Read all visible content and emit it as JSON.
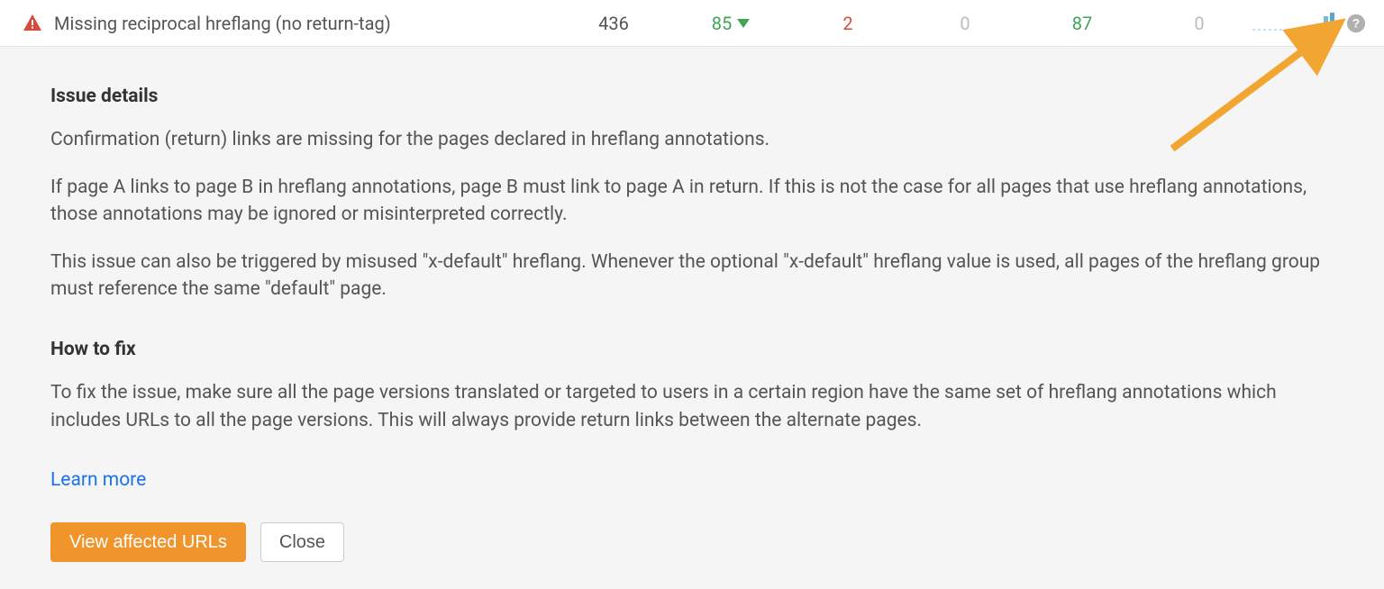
{
  "row": {
    "title": "Missing reciprocal hreflang (no return-tag)",
    "total": "436",
    "change": "85",
    "new": "2",
    "zero1": "0",
    "fixed": "87",
    "zero2": "0"
  },
  "details": {
    "heading": "Issue details",
    "p1": "Confirmation (return) links are missing for the pages declared in hreflang annotations.",
    "p2": "If page A links to page B in hreflang annotations, page B must link to page A in return. If this is not the case for all pages that use hreflang annotations, those annotations may be ignored or misinterpreted correctly.",
    "p3": "This issue can also be triggered by misused \"x-default\" hreflang. Whenever the optional \"x-default\" hreflang value is used, all pages of the hreflang group must reference the same \"default\" page."
  },
  "fix": {
    "heading": "How to fix",
    "p1": "To fix the issue, make sure all the page versions translated or targeted to users in a certain region have the same set of hreflang annotations which includes URLs to all the page versions. This will always provide return links between the alternate pages."
  },
  "links": {
    "learn_more": "Learn more"
  },
  "buttons": {
    "view_affected": "View affected URLs",
    "close": "Close"
  }
}
